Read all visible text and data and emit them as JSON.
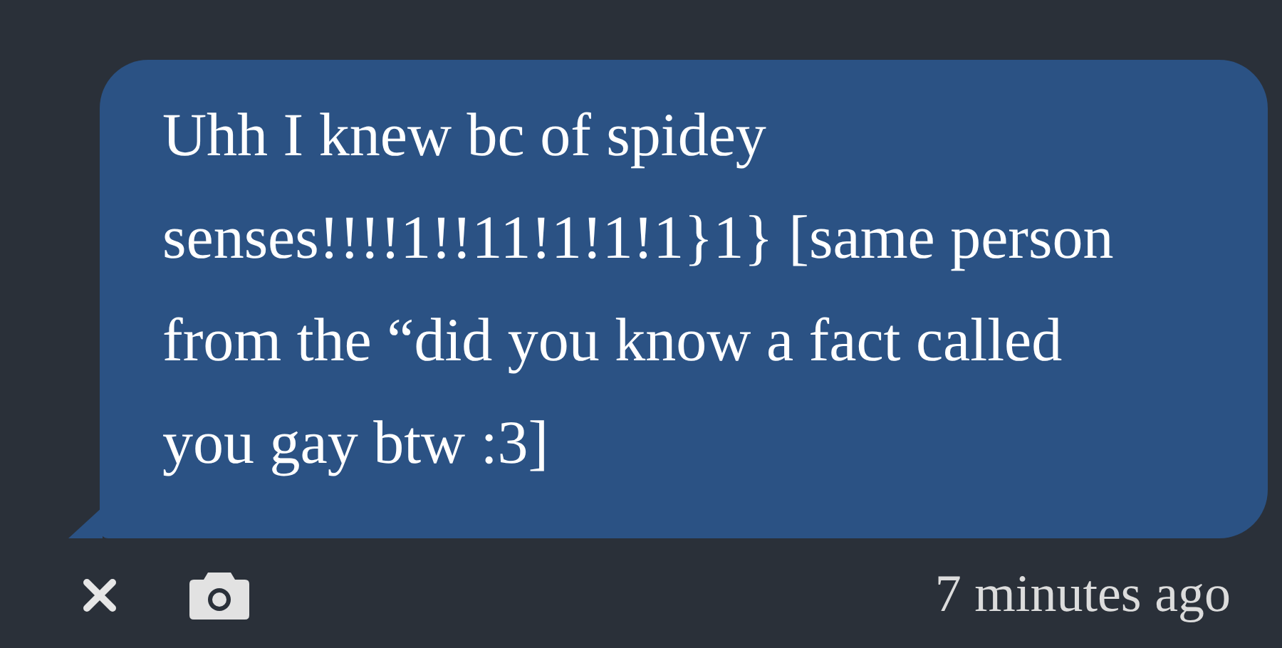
{
  "message": {
    "text": "Uhh I knew bc of spidey senses!!!!1!!11!1!1!1}1} [same person from the “did you know a fact called you gay btw :3]"
  },
  "footer": {
    "timestamp": "7 minutes ago"
  }
}
